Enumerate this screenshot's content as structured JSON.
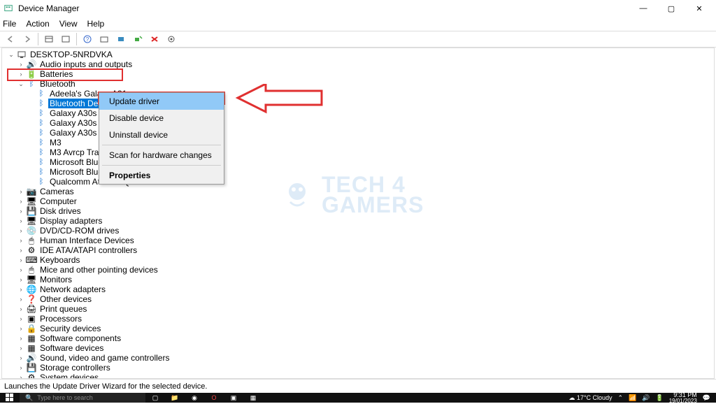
{
  "window": {
    "title": "Device Manager",
    "minimize": "—",
    "maximize": "▢",
    "close": "✕"
  },
  "menu": {
    "file": "File",
    "action": "Action",
    "view": "View",
    "help": "Help"
  },
  "tree": {
    "root": "DESKTOP-5NRDVKA",
    "audio": "Audio inputs and outputs",
    "batteries": "Batteries",
    "bluetooth": "Bluetooth",
    "bt_items": {
      "adeela": "Adeela's Galaxy A31",
      "btdevice": "Bluetooth Device (",
      "galaxy1": "Galaxy A30s",
      "galaxy2": "Galaxy A30s",
      "galaxy_avrcp": "Galaxy A30s Avrcp T",
      "m3": "M3",
      "m3avrcp": "M3 Avrcp Transport",
      "msbt": "Microsoft Bluetooth",
      "msbt_enum": "Microsoft Bluetooth LE Enumerator",
      "qualcomm": "Qualcomm Atheros QCA9377 Bluetooth"
    },
    "cameras": "Cameras",
    "computer": "Computer",
    "disk": "Disk drives",
    "display": "Display adapters",
    "dvd": "DVD/CD-ROM drives",
    "hid": "Human Interface Devices",
    "ide": "IDE ATA/ATAPI controllers",
    "keyboards": "Keyboards",
    "mice": "Mice and other pointing devices",
    "monitors": "Monitors",
    "network": "Network adapters",
    "other": "Other devices",
    "print": "Print queues",
    "processors": "Processors",
    "security": "Security devices",
    "swcomp": "Software components",
    "swdev": "Software devices",
    "sound": "Sound, video and game controllers",
    "storage": "Storage controllers",
    "system": "System devices"
  },
  "context_menu": {
    "update": "Update driver",
    "disable": "Disable device",
    "uninstall": "Uninstall device",
    "scan": "Scan for hardware changes",
    "properties": "Properties"
  },
  "statusbar": {
    "text": "Launches the Update Driver Wizard for the selected device."
  },
  "taskbar": {
    "search_placeholder": "Type here to search",
    "weather": "17°C  Cloudy",
    "time": "9:31 PM",
    "date": "19/01/2023"
  },
  "watermark": {
    "line1": "TECH 4",
    "line2": "GAMERS"
  }
}
